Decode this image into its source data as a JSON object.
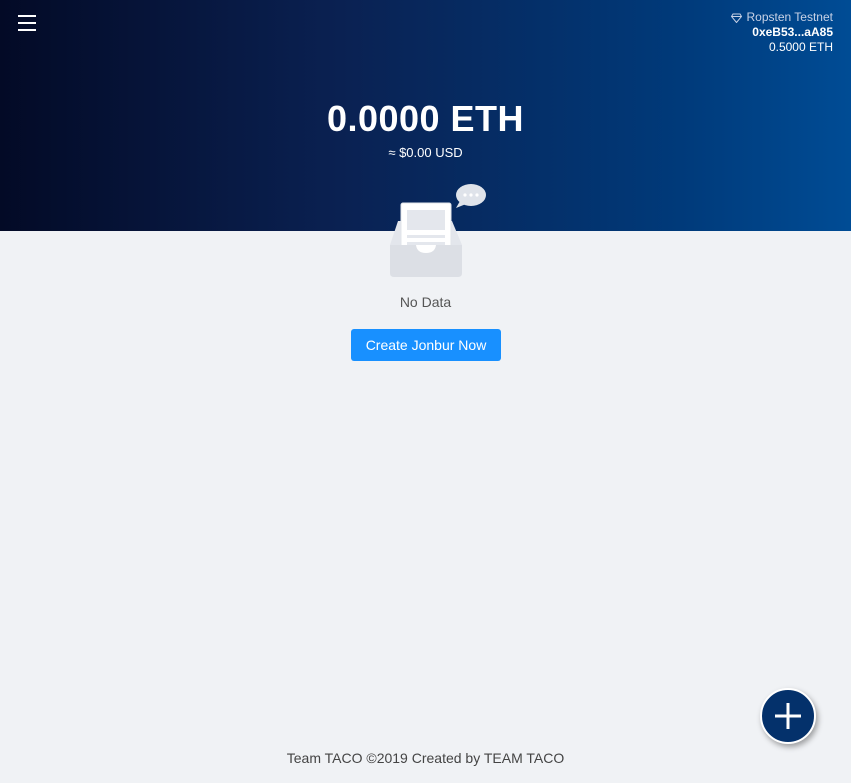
{
  "header": {
    "network": "Ropsten Testnet",
    "network_icon": "diamond-icon",
    "address": "0xeB53...aA85",
    "network_balance": "0.5000 ETH",
    "balance": "0.0000 ETH",
    "usd_value": "≈ $0.00 USD"
  },
  "empty_state": {
    "text": "No Data",
    "icon": "empty-inbox-icon"
  },
  "actions": {
    "create_label": "Create Jonbur Now",
    "add_icon": "plus-icon",
    "menu_icon": "hamburger-menu-icon"
  },
  "footer": {
    "text": "Team TACO ©2019 Created by TEAM TACO"
  },
  "colors": {
    "primary": "#1890ff",
    "fab": "#04316b",
    "header_start": "#030a26",
    "header_end": "#004c95"
  }
}
